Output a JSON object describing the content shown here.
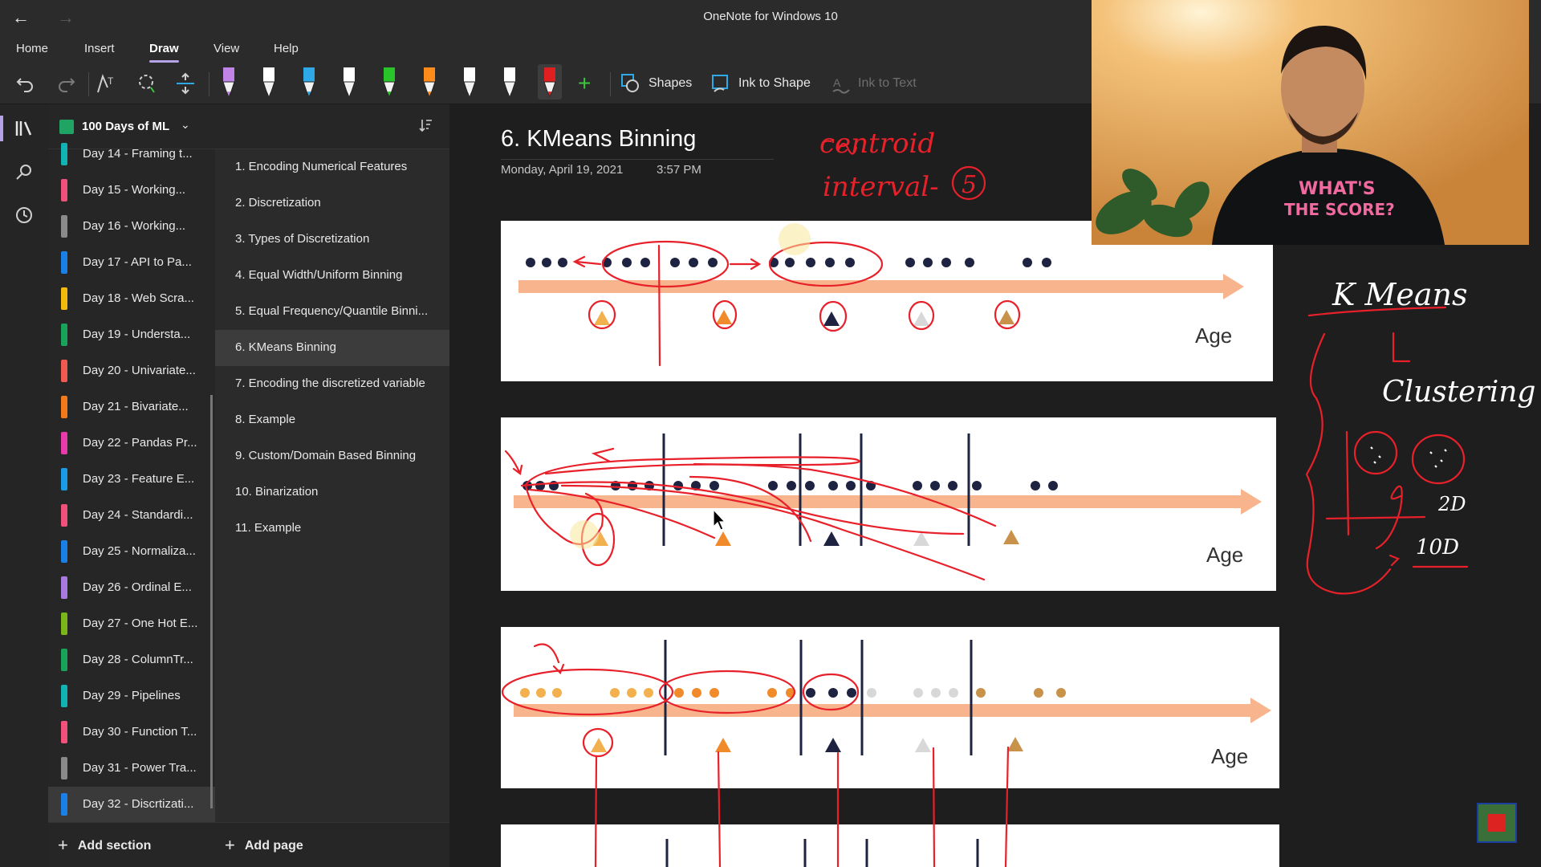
{
  "window": {
    "title": "OneNote for Windows 10"
  },
  "menu": {
    "tabs": [
      "Home",
      "Insert",
      "Draw",
      "View",
      "Help"
    ],
    "active": "Draw"
  },
  "ribbon": {
    "shapes_label": "Shapes",
    "ink_to_shape_label": "Ink to Shape",
    "ink_to_text_label": "Ink to Text",
    "pens": [
      "#c084e6",
      "#ffffff",
      "#2ea8e6",
      "#ffffff",
      "#29c429",
      "#ff8c1a",
      "#ffffff",
      "#ffffff",
      "#e02020"
    ]
  },
  "notebook": {
    "name": "100 Days of ML"
  },
  "sections": [
    {
      "label": "Day 14 - Framing t...",
      "color": "#12b3b3"
    },
    {
      "label": "Day 15 - Working...",
      "color": "#f0507a"
    },
    {
      "label": "Day 16 - Working...",
      "color": "#8a8a8a"
    },
    {
      "label": "Day 17 - API to Pa...",
      "color": "#1a7fe6"
    },
    {
      "label": "Day 18 - Web Scra...",
      "color": "#f2b90f"
    },
    {
      "label": "Day 19 - Understa...",
      "color": "#19a35a"
    },
    {
      "label": "Day 20 - Univariate...",
      "color": "#f05a50"
    },
    {
      "label": "Day 21 - Bivariate...",
      "color": "#f27a1a"
    },
    {
      "label": "Day 22 - Pandas Pr...",
      "color": "#e83aa8"
    },
    {
      "label": "Day 23 - Feature E...",
      "color": "#1a9be6"
    },
    {
      "label": "Day 24 - Standardi...",
      "color": "#f0507a"
    },
    {
      "label": "Day 25 - Normaliza...",
      "color": "#1a7fe6"
    },
    {
      "label": "Day 26 - Ordinal E...",
      "color": "#a87ae0"
    },
    {
      "label": "Day 27 - One Hot E...",
      "color": "#7ab51a"
    },
    {
      "label": "Day 28 - ColumnTr...",
      "color": "#19a35a"
    },
    {
      "label": "Day 29 - Pipelines",
      "color": "#12b3b3"
    },
    {
      "label": "Day 30 - Function T...",
      "color": "#f0507a"
    },
    {
      "label": "Day 31 - Power Tra...",
      "color": "#8a8a8a"
    },
    {
      "label": "Day 32 - Discrtizati...",
      "color": "#1a7fe6"
    }
  ],
  "active_section": 18,
  "pages": [
    "1. Encoding Numerical Features",
    "2. Discretization",
    "3. Types of Discretization",
    "4. Equal Width/Uniform Binning",
    "5. Equal Frequency/Quantile Binni...",
    "6. KMeans Binning",
    "7. Encoding the discretized variable",
    "8. Example",
    "9. Custom/Domain Based Binning",
    "10. Binarization",
    "11. Example"
  ],
  "active_page": 5,
  "footer": {
    "add_section": "Add section",
    "add_page": "Add page"
  },
  "page": {
    "title": "6. KMeans Binning",
    "date": "Monday, April 19, 2021",
    "time": "3:57 PM"
  },
  "slides": [
    {
      "axis_label": "Age"
    },
    {
      "axis_label": "Age"
    },
    {
      "axis_label": "Age"
    }
  ],
  "ink_text": {
    "centroid": "centroid",
    "interval": "interval-",
    "interval_count": "5",
    "kmeans": "K Means",
    "clustering": "Clustering",
    "two_d": "2D",
    "ten_d": "10D"
  },
  "webcam": {
    "shirt_text_1": "WHAT'S",
    "shirt_text_2": "THE SCORE?"
  }
}
